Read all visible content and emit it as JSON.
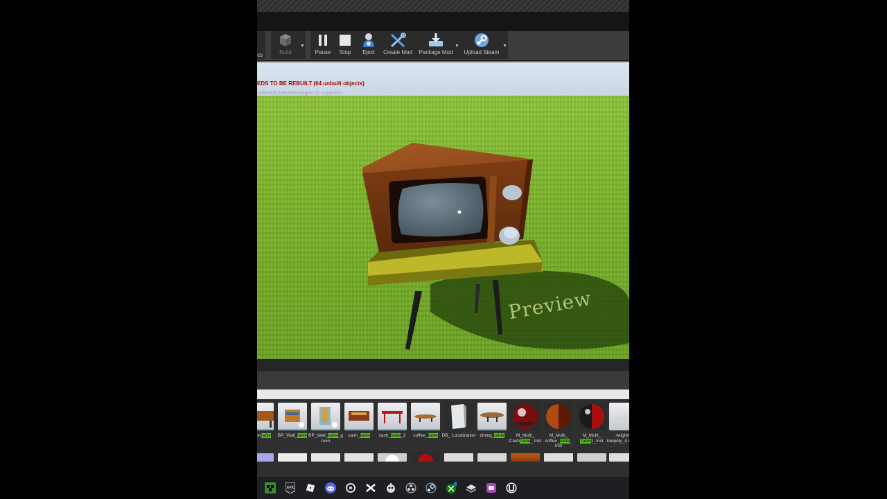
{
  "toolbar": {
    "cut_left_label": "cs",
    "build_label": "Build",
    "pause_label": "Pause",
    "stop_label": "Stop",
    "eject_label": "Eject",
    "create_mod_label": "Create Mod",
    "package_mod_label": "Package Mod",
    "upload_steam_label": "Upload Steam"
  },
  "viewport": {
    "warning": "EDS TO BE REBUILT (64 unbuilt objects)",
    "suppress_hint": "ableAllScreenMessages' to suppress",
    "watermark": "Preview"
  },
  "assets": [
    {
      "pre": "eacher",
      "hl": "table",
      "post": ""
    },
    {
      "pre": "BP_Wall_",
      "hl": "table",
      "post": ""
    },
    {
      "pre": "BP_Wall_",
      "hl": "table",
      "post": "_green"
    },
    {
      "pre": "cash_",
      "hl": "table",
      "post": ""
    },
    {
      "pre": "cash_",
      "hl": "table",
      "post": "_2"
    },
    {
      "pre": "coffee_",
      "hl": "table",
      "post": ""
    },
    {
      "pre": "DB_ Localization",
      "hl": "",
      "post": ""
    },
    {
      "pre": "dining_",
      "hl": "table",
      "post": ""
    },
    {
      "pre": "M_Multi_ Cash",
      "hl": "Table",
      "post": "_ Inst"
    },
    {
      "pre": "M_Multi_ coffee_",
      "hl": "table",
      "post": "_ Inst"
    },
    {
      "pre": "M_Multi_ ",
      "hl": "Table",
      "post": "1_Inst"
    },
    {
      "pre": "neighbo lowpoly_A rio_sit",
      "hl": "",
      "post": ""
    }
  ],
  "taskbar_icons": [
    "minecraft-icon",
    "epic-games-icon",
    "roblox-icon",
    "discord-icon",
    "steam-like-icon",
    "capcut-icon",
    "robot-icon",
    "obs-icon",
    "steam-icon",
    "xbox-icon",
    "stack-icon",
    "gamepad-icon",
    "unreal-engine-icon"
  ],
  "colors": {
    "grass": "#7cb52a",
    "highlight": "#55c21c",
    "warning_red": "#b30000",
    "tv_wood": "#7a3a12",
    "table_top": "#b8b422"
  }
}
